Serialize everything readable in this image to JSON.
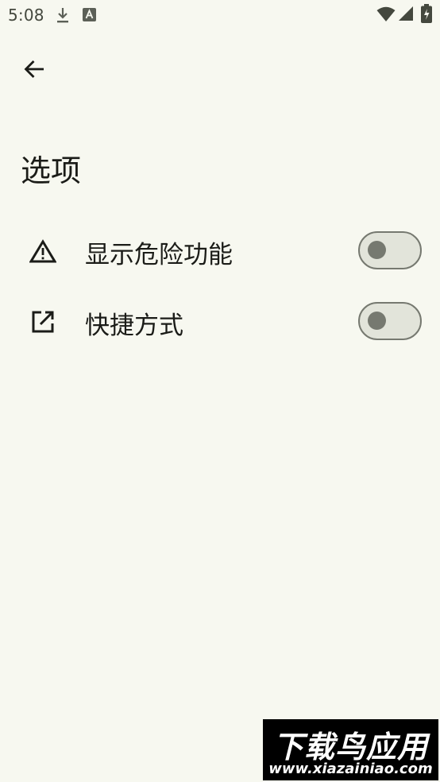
{
  "status_bar": {
    "time": "5:08",
    "icons": [
      "download-icon",
      "text-a-icon",
      "wifi-icon",
      "signal-icon",
      "battery-icon"
    ]
  },
  "toolbar": {
    "back_icon": "arrow-back-icon"
  },
  "page": {
    "title": "选项"
  },
  "options": [
    {
      "icon": "warning-triangle-icon",
      "label": "显示危险功能",
      "enabled": false
    },
    {
      "icon": "open-in-new-icon",
      "label": "快捷方式",
      "enabled": false
    }
  ],
  "colors": {
    "background": "#f7f8f0",
    "text": "#1b1c18",
    "switch_track": "#e2e4da",
    "switch_outline": "#767970"
  },
  "watermark": {
    "main": "下载鸟应用",
    "sub": "www.xiazainiao.com"
  }
}
